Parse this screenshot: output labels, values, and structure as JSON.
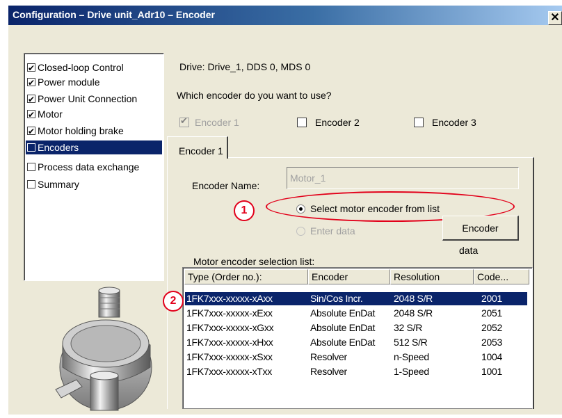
{
  "window": {
    "title": "Configuration – Drive unit_Adr10 – Encoder",
    "close_glyph": "✕"
  },
  "tree": {
    "items": [
      {
        "label": "Closed-loop Control",
        "checked": true
      },
      {
        "label": "Power module",
        "checked": true
      },
      {
        "label": "Power Unit Connection",
        "checked": true
      },
      {
        "label": "Motor",
        "checked": true
      },
      {
        "label": "Motor holding brake",
        "checked": true
      },
      {
        "label": "Encoders",
        "checked": false,
        "selected": true
      },
      {
        "label": "Process data exchange",
        "checked": false
      },
      {
        "label": "Summary",
        "checked": false
      }
    ]
  },
  "drive_info": "Drive: Drive_1, DDS 0, MDS 0",
  "question": "Which encoder do you want to use?",
  "encoder_checkboxes": [
    {
      "label": "Encoder 1",
      "checked": true,
      "disabled": true
    },
    {
      "label": "Encoder 2",
      "checked": false
    },
    {
      "label": "Encoder 3",
      "checked": false
    }
  ],
  "tab": {
    "label": "Encoder 1"
  },
  "encoder_name": {
    "label": "Encoder Name:",
    "value": "Motor_1"
  },
  "radios": {
    "select_from_list": "Select motor encoder from list",
    "enter_data": "Enter data"
  },
  "encoder_data_button": {
    "line1": "Encoder",
    "line2": "data"
  },
  "list": {
    "title": "Motor encoder selection list:",
    "columns": [
      "Type (Order no.):",
      "Encoder",
      "Resolution",
      "Code..."
    ],
    "rows": [
      [
        "1FK7xxx-xxxxx-xAxx",
        "Sin/Cos Incr.",
        "2048 S/R",
        "2001"
      ],
      [
        "1FK7xxx-xxxxx-xExx",
        "Absolute EnDat",
        "2048 S/R",
        "2051"
      ],
      [
        "1FK7xxx-xxxxx-xGxx",
        "Absolute EnDat",
        "32 S/R",
        "2052"
      ],
      [
        "1FK7xxx-xxxxx-xHxx",
        "Absolute EnDat",
        "512 S/R",
        "2053"
      ],
      [
        "1FK7xxx-xxxxx-xSxx",
        "Resolver",
        "n-Speed",
        "1004"
      ],
      [
        "1FK7xxx-xxxxx-xTxx",
        "Resolver",
        "1-Speed",
        "1001"
      ]
    ]
  },
  "callouts": [
    "1",
    "2"
  ],
  "colors": {
    "highlight": "#0a246a",
    "annotation_red": "#e2001a",
    "dialog_bg": "#ece9d8"
  }
}
